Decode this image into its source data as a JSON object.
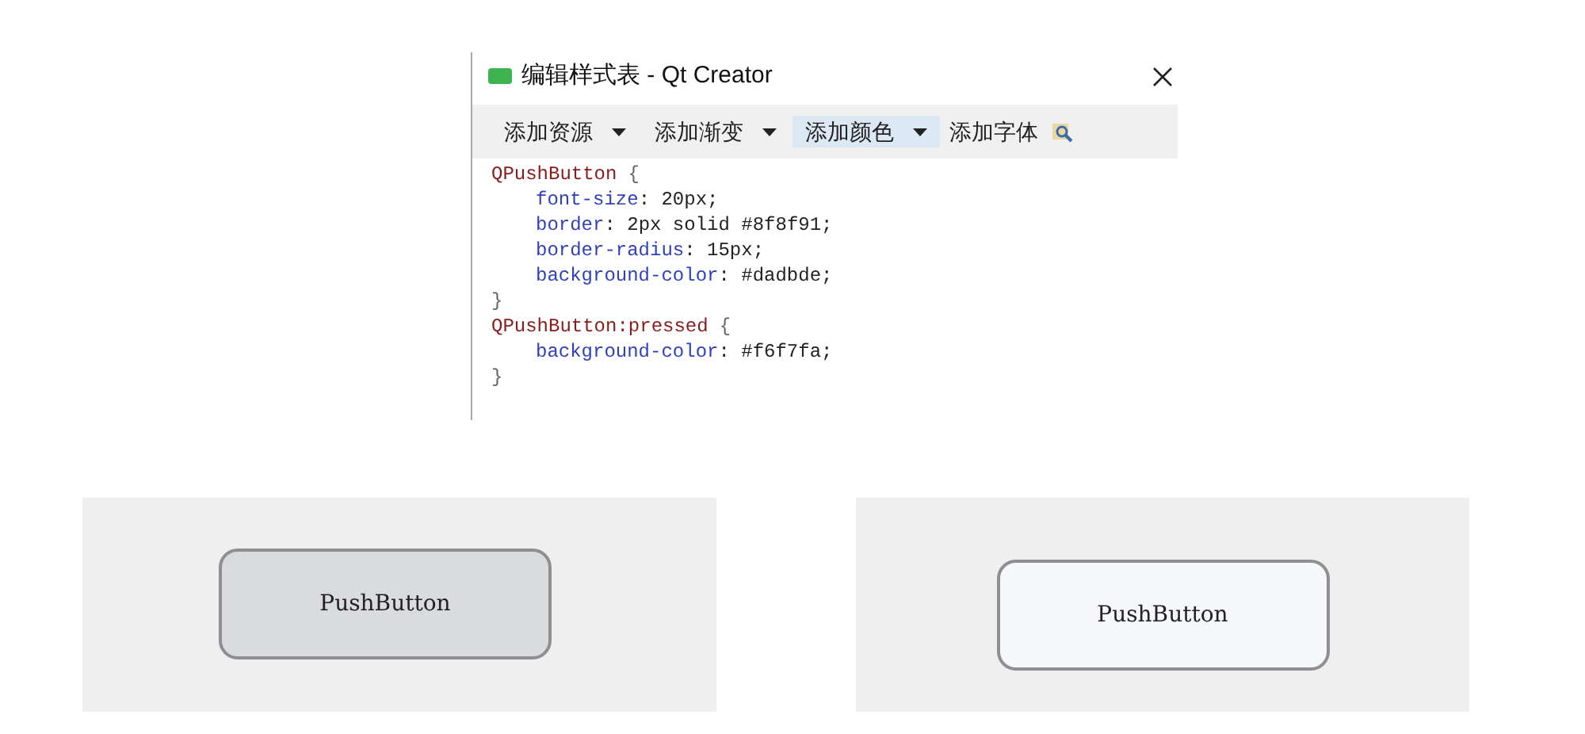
{
  "window": {
    "title": "编辑样式表 - Qt Creator"
  },
  "toolbar": [
    {
      "kind": "dropdown",
      "label": "添加资源",
      "selected": false
    },
    {
      "kind": "dropdown",
      "label": "添加渐变",
      "selected": false
    },
    {
      "kind": "dropdown",
      "label": "添加颜色",
      "selected": true
    },
    {
      "kind": "button",
      "label": "添加字体",
      "selected": false
    },
    {
      "kind": "icon",
      "selected": false
    }
  ],
  "code_lines": [
    {
      "kind": "selector",
      "selector": "QPushButton",
      "brace": "{"
    },
    {
      "kind": "declaration",
      "property": "font-size",
      "value": ": 20px;"
    },
    {
      "kind": "declaration",
      "property": "border",
      "value": ": 2px solid #8f8f91;"
    },
    {
      "kind": "declaration",
      "property": "border-radius",
      "value": ": 15px;"
    },
    {
      "kind": "declaration",
      "property": "background-color",
      "value": ": #dadbde;"
    },
    {
      "kind": "close",
      "brace": "}"
    },
    {
      "kind": "selector",
      "selector": "QPushButton:pressed",
      "brace": "{"
    },
    {
      "kind": "declaration",
      "property": "background-color",
      "value": ": #f6f7fa;"
    },
    {
      "kind": "close",
      "brace": "}"
    }
  ],
  "previews": [
    {
      "label": "PushButton",
      "color": "#dadbde"
    },
    {
      "label": "PushButton",
      "color": "#f6f7fa"
    }
  ]
}
